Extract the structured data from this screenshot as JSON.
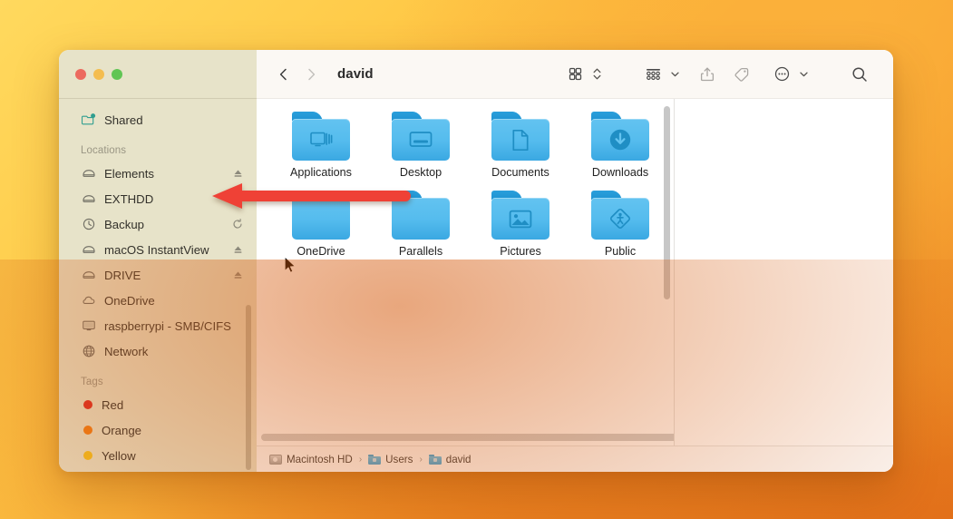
{
  "window": {
    "title": "david",
    "traffic_lights": [
      {
        "name": "close",
        "color": "#ec6a5e"
      },
      {
        "name": "minimize",
        "color": "#f4bd4f"
      },
      {
        "name": "maximize",
        "color": "#61c554"
      }
    ]
  },
  "toolbar": {
    "back_label": "Back",
    "forward_label": "Forward",
    "title": "david",
    "buttons": [
      {
        "name": "view-mode-icon",
        "label": "Icon view"
      },
      {
        "name": "view-stepper-icon",
        "label": "View options"
      },
      {
        "name": "group-by-icon",
        "label": "Group items"
      },
      {
        "name": "group-chevron-icon",
        "label": "Group menu"
      },
      {
        "name": "share-icon",
        "label": "Share"
      },
      {
        "name": "tag-icon",
        "label": "Tags"
      },
      {
        "name": "more-icon",
        "label": "More"
      },
      {
        "name": "more-chevron-icon",
        "label": "More menu"
      },
      {
        "name": "search-icon",
        "label": "Search"
      }
    ]
  },
  "sidebar": {
    "top_items": [
      {
        "label": "Shared",
        "icon": "shared-folder-icon",
        "action": ""
      }
    ],
    "sections": [
      {
        "title": "Locations",
        "items": [
          {
            "label": "Elements",
            "icon": "drive-icon",
            "action": "eject-icon"
          },
          {
            "label": "EXTHDD",
            "icon": "drive-icon",
            "action": "eject-icon"
          },
          {
            "label": "Backup",
            "icon": "time-machine-icon",
            "action": "sync-icon"
          },
          {
            "label": "macOS InstantView",
            "icon": "drive-icon",
            "action": "eject-icon"
          },
          {
            "label": "DRIVE",
            "icon": "drive-icon",
            "action": "eject-icon"
          },
          {
            "label": "OneDrive",
            "icon": "cloud-icon",
            "action": ""
          },
          {
            "label": "raspberrypi - SMB/CIFS",
            "icon": "display-icon",
            "action": ""
          },
          {
            "label": "Network",
            "icon": "globe-icon",
            "action": ""
          }
        ]
      },
      {
        "title": "Tags",
        "items": [
          {
            "label": "Red",
            "icon": "tag-dot",
            "color": "#dd2a23",
            "action": ""
          },
          {
            "label": "Orange",
            "icon": "tag-dot",
            "color": "#f07d16",
            "action": ""
          },
          {
            "label": "Yellow",
            "icon": "tag-dot",
            "color": "#f4c220",
            "action": ""
          }
        ]
      }
    ]
  },
  "files": [
    {
      "name": "Applications",
      "glyph": "applications-glyph"
    },
    {
      "name": "Desktop",
      "glyph": "desktop-glyph"
    },
    {
      "name": "Documents",
      "glyph": "document-glyph"
    },
    {
      "name": "Downloads",
      "glyph": "download-glyph"
    },
    {
      "name": "OneDrive",
      "glyph": "none"
    },
    {
      "name": "Parallels",
      "glyph": "none"
    },
    {
      "name": "Pictures",
      "glyph": "picture-glyph"
    },
    {
      "name": "Public",
      "glyph": "public-glyph"
    }
  ],
  "path_bar": {
    "crumbs": [
      {
        "label": "Macintosh HD",
        "icon": "hard-drive-icon"
      },
      {
        "label": "Users",
        "icon": "folder-icon"
      },
      {
        "label": "david",
        "icon": "folder-icon"
      }
    ],
    "separator": "›"
  },
  "annotation": {
    "arrow_color": "#ef4136",
    "points_to": "EXTHDD eject button"
  }
}
